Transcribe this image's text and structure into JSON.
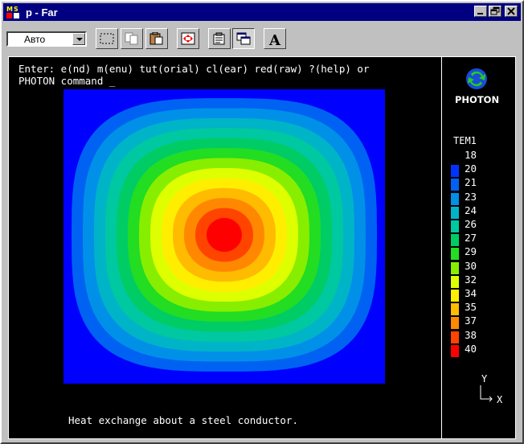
{
  "window": {
    "title": "p - Far",
    "app_icon_letters": "MS"
  },
  "toolbar": {
    "font_combo_value": "Авто",
    "tools": [
      "mark-icon",
      "copy-icon",
      "paste-icon",
      "fullscreen-icon",
      "properties-icon",
      "background-icon",
      "font-icon"
    ],
    "font_tool_glyph": "A"
  },
  "console": {
    "prompt_line1": "Enter: e(nd) m(enu) tut(orial) cl(ear) red(raw) ?(help) or",
    "prompt_line2": "PHOTON command _",
    "caption": "Heat exchange about a steel conductor."
  },
  "logo": {
    "label": "PHOTON"
  },
  "legend": {
    "title": "TEM1",
    "entries": [
      {
        "label": "18",
        "color": ""
      },
      {
        "label": "20",
        "color": "#0033ff"
      },
      {
        "label": "21",
        "color": "#0062f2"
      },
      {
        "label": "23",
        "color": "#0090e8"
      },
      {
        "label": "24",
        "color": "#00b4c8"
      },
      {
        "label": "26",
        "color": "#00c8a0"
      },
      {
        "label": "27",
        "color": "#00cc66"
      },
      {
        "label": "29",
        "color": "#22dd22"
      },
      {
        "label": "30",
        "color": "#88ee00"
      },
      {
        "label": "32",
        "color": "#ddff00"
      },
      {
        "label": "34",
        "color": "#ffee00"
      },
      {
        "label": "35",
        "color": "#ffbb00"
      },
      {
        "label": "37",
        "color": "#ff8800"
      },
      {
        "label": "38",
        "color": "#ff4400"
      },
      {
        "label": "40",
        "color": "#ff0000"
      }
    ]
  },
  "axes": {
    "y_label": "Y",
    "x_label": "X"
  },
  "colors": {
    "plot_background": "#0000ff",
    "title_bar": "#000080"
  }
}
